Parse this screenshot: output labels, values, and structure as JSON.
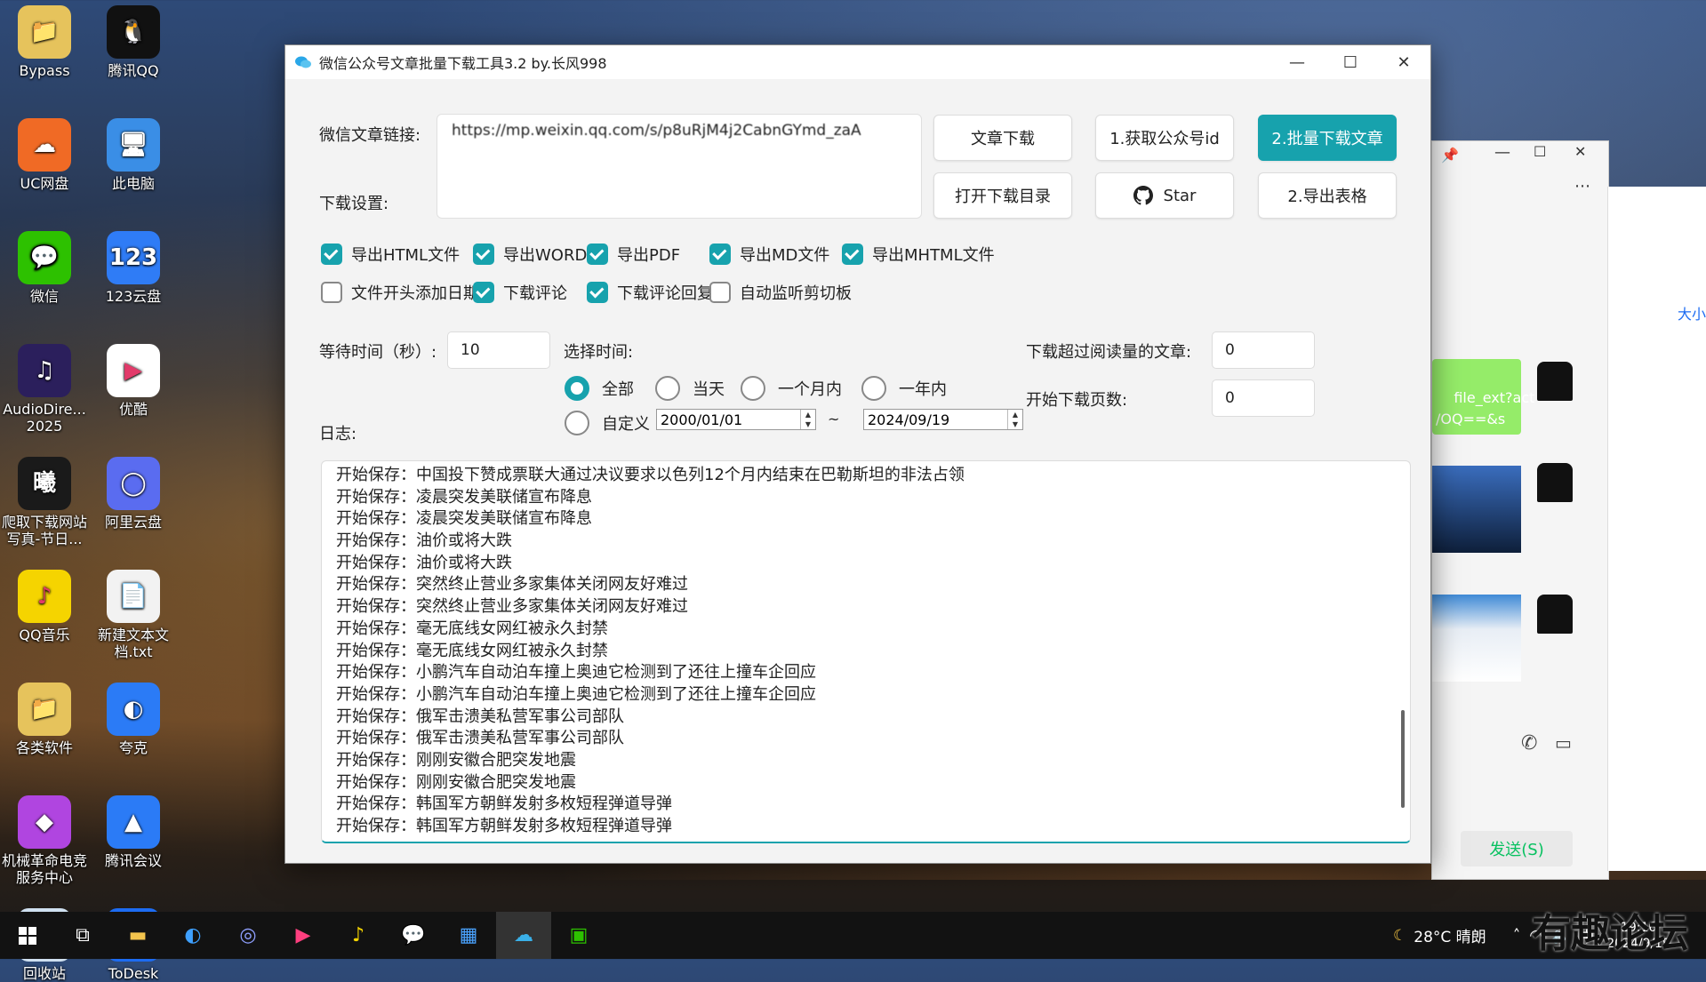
{
  "desktop": {
    "icons": [
      {
        "label": "Bypass",
        "color": "#e6c35c",
        "glyph": "📁"
      },
      {
        "label": "腾讯QQ",
        "color": "#111111",
        "glyph": "🐧"
      },
      {
        "label": "UC网盘",
        "color": "#f06a25",
        "glyph": "☁"
      },
      {
        "label": "此电脑",
        "color": "#3a8ee6",
        "glyph": "🖥"
      },
      {
        "label": "微信",
        "color": "#2dc100",
        "glyph": "💬"
      },
      {
        "label": "123云盘",
        "color": "#2f7cf6",
        "glyph": "123"
      },
      {
        "label": "AudioDire... 2025",
        "color": "#2b1f5c",
        "glyph": "♫"
      },
      {
        "label": "优酷",
        "color": "#ffffff",
        "glyph": "▶"
      },
      {
        "label": "爬取下载网站写真-节日...",
        "color": "#1a1a1a",
        "glyph": "曦"
      },
      {
        "label": "阿里云盘",
        "color": "#5a6cf0",
        "glyph": "◯"
      },
      {
        "label": "QQ音乐",
        "color": "#f5d400",
        "glyph": "♪"
      },
      {
        "label": "新建文本文档.txt",
        "color": "#f2f2f2",
        "glyph": "📄"
      },
      {
        "label": "各类软件",
        "color": "#e6c35c",
        "glyph": "📁"
      },
      {
        "label": "夸克",
        "color": "#2b7bf6",
        "glyph": "◐"
      },
      {
        "label": "机械革命电竞服务中心",
        "color": "#b045e0",
        "glyph": "◆"
      },
      {
        "label": "腾讯会议",
        "color": "#2b7bf6",
        "glyph": "▲"
      },
      {
        "label": "回收站",
        "color": "#cfe0f0",
        "glyph": "♻"
      },
      {
        "label": "ToDesk",
        "color": "#1d6cf2",
        "glyph": "T"
      }
    ]
  },
  "window": {
    "title": "微信公众号文章批量下载工具3.2 by.长风998",
    "minimize": "—",
    "maximize": "☐",
    "close": "✕"
  },
  "form": {
    "url_label": "微信文章链接:",
    "url_value": "https://mp.weixin.qq.com/s/p8uRjM4j2CabnGYmd_zaA",
    "settings_label": "下载设置:",
    "buttons": {
      "article_download": "文章下载",
      "get_account_id": "1.获取公众号id",
      "batch_download": "2.批量下载文章",
      "open_dir": "打开下载目录",
      "star": "Star",
      "export_table": "2.导出表格"
    },
    "checkboxes": [
      {
        "label": "导出HTML文件",
        "checked": true
      },
      {
        "label": "导出WORD",
        "checked": true
      },
      {
        "label": "导出PDF",
        "checked": true
      },
      {
        "label": "导出MD文件",
        "checked": true
      },
      {
        "label": "导出MHTML文件",
        "checked": true
      },
      {
        "label": "文件开头添加日期",
        "checked": false
      },
      {
        "label": "下载评论",
        "checked": true
      },
      {
        "label": "下载评论回复",
        "checked": true
      },
      {
        "label": "自动监听剪切板",
        "checked": false
      }
    ],
    "wait_label": "等待时间（秒）:",
    "wait_value": "10",
    "select_time_label": "选择时间:",
    "radios": [
      {
        "label": "全部",
        "selected": true
      },
      {
        "label": "当天",
        "selected": false
      },
      {
        "label": "一个月内",
        "selected": false
      },
      {
        "label": "一年内",
        "selected": false
      },
      {
        "label": "自定义",
        "selected": false
      }
    ],
    "date_from": "2000/01/01",
    "date_sep": "~",
    "date_to": "2024/09/19",
    "read_threshold_label": "下载超过阅读量的文章:",
    "read_threshold_value": "0",
    "start_page_label": "开始下载页数:",
    "start_page_value": "0",
    "log_label": "日志:"
  },
  "log_lines": [
    "开始保存：中国投下赞成票联大通过决议要求以色列12个月内结束在巴勒斯坦的非法占领",
    "开始保存：凌晨突发美联储宣布降息",
    "开始保存：凌晨突发美联储宣布降息",
    "开始保存：油价或将大跌",
    "开始保存：油价或将大跌",
    "开始保存：突然终止营业多家集体关闭网友好难过",
    "开始保存：突然终止营业多家集体关闭网友好难过",
    "开始保存：毫无底线女网红被永久封禁",
    "开始保存：毫无底线女网红被永久封禁",
    "开始保存：小鹏汽车自动泊车撞上奥迪它检测到了还往上撞车企回应",
    "开始保存：小鹏汽车自动泊车撞上奥迪它检测到了还往上撞车企回应",
    "开始保存：俄军击溃美私营军事公司部队",
    "开始保存：俄军击溃美私营军事公司部队",
    "开始保存：刚刚安徽合肥突发地震",
    "开始保存：刚刚安徽合肥突发地震",
    "开始保存：韩国军方朝鲜发射多枚短程弹道导弹",
    "开始保存：韩国军方朝鲜发射多枚短程弹道导弹"
  ],
  "chat": {
    "bubble_text": "file_ext?act\n/OQ==&s",
    "side_label": "大小",
    "send_label": "发送(S)"
  },
  "taskbar": {
    "weather": "28°C 晴朗",
    "time": "19:16",
    "date": "2024/9/19",
    "ime": "中",
    "watermark": "有趣论坛"
  }
}
